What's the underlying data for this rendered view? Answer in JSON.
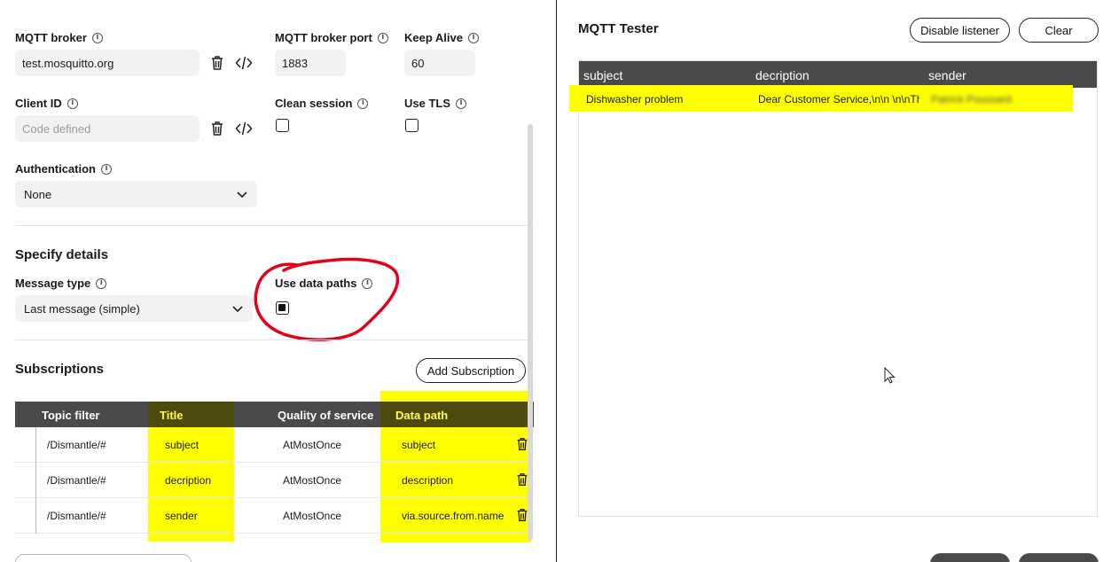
{
  "form": {
    "broker_label": "MQTT broker",
    "broker_value": "test.mosquitto.org",
    "port_label": "MQTT broker port",
    "port_value": "1883",
    "keepalive_label": "Keep Alive",
    "keepalive_value": "60",
    "client_id_label": "Client ID",
    "client_id_placeholder": "Code defined",
    "clean_session_label": "Clean session",
    "use_tls_label": "Use TLS",
    "auth_label": "Authentication",
    "auth_value": "None"
  },
  "details": {
    "heading": "Specify details",
    "message_type_label": "Message type",
    "message_type_value": "Last message (simple)",
    "use_data_paths_label": "Use data paths",
    "use_data_paths_checked": true
  },
  "subscriptions": {
    "heading": "Subscriptions",
    "add_button": "Add Subscription",
    "columns": [
      "Topic filter",
      "Title",
      "Quality of service",
      "Data path"
    ],
    "rows": [
      {
        "topic": "/Dismantle/#",
        "title": "subject",
        "qos": "AtMostOnce",
        "path": "subject"
      },
      {
        "topic": "/Dismantle/#",
        "title": "decription",
        "qos": "AtMostOnce",
        "path": "description"
      },
      {
        "topic": "/Dismantle/#",
        "title": "sender",
        "qos": "AtMostOnce",
        "path": "via.source.from.name"
      }
    ]
  },
  "tester": {
    "title": "MQTT Tester",
    "disable_button": "Disable listener",
    "clear_button": "Clear",
    "columns": [
      "subject",
      "decription",
      "sender"
    ],
    "rows": [
      {
        "subject": "Dishwasher problem",
        "decription": "Dear Customer Service,\\n\\n \\n\\nTh",
        "sender": "Patrick Poussard"
      }
    ]
  },
  "colors": {
    "highlight": "#ffff00",
    "annotation": "#e3001b",
    "header_bg": "#4a4a4a"
  },
  "icons": [
    "info-icon",
    "trash-icon",
    "code-icon",
    "chevron-down-icon",
    "mouse-cursor-icon"
  ]
}
